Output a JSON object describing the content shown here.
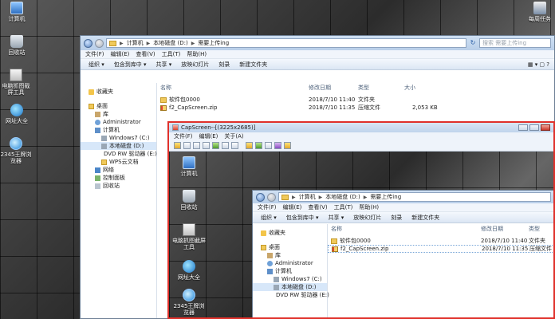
{
  "desktop": {
    "icons": [
      {
        "label": "计算机",
        "icon": "computer-icon"
      },
      {
        "label": "回收站",
        "icon": "recycle-bin-icon"
      },
      {
        "label": "电脑抓图截屏工具",
        "icon": "capture-tool-icon"
      },
      {
        "label": "网址大全",
        "icon": "web-directory-icon"
      },
      {
        "label": "2345王牌浏览器",
        "icon": "browser-icon"
      },
      {
        "label": "每周任务",
        "icon": "games-icon"
      }
    ]
  },
  "explorer": {
    "breadcrumb": [
      "计算机",
      "本地磁盘 (D:)",
      "需要上传ing"
    ],
    "search_placeholder": "搜索 需要上传ing",
    "menu": [
      "文件(F)",
      "编辑(E)",
      "查看(V)",
      "工具(T)",
      "帮助(H)"
    ],
    "commands": [
      "组织 ▾",
      "包含到库中 ▾",
      "共享 ▾",
      "放映幻灯片",
      "刻录",
      "新建文件夹"
    ],
    "columns": {
      "name": "名称",
      "date": "修改日期",
      "type": "类型",
      "size": "大小"
    },
    "files": [
      {
        "name": "软件包0000",
        "date": "2018/7/10 11:40",
        "type": "文件夹",
        "size": "",
        "icon": "folder-icon"
      },
      {
        "name": "f2_CapScreen.zip",
        "date": "2018/7/10 11:35",
        "type": "压缩文件",
        "size": "2,053 KB",
        "icon": "zip-icon"
      }
    ],
    "nav": [
      {
        "label": "收藏夹",
        "icon": "star",
        "level": 0
      },
      {
        "label": "桌面",
        "icon": "folder",
        "level": 0
      },
      {
        "label": "库",
        "icon": "lib",
        "level": 1
      },
      {
        "label": "Administrator",
        "icon": "user",
        "level": 1
      },
      {
        "label": "计算机",
        "icon": "pc",
        "level": 1
      },
      {
        "label": "Windows7 (C:)",
        "icon": "drive",
        "level": 2
      },
      {
        "label": "本地磁盘 (D:)",
        "icon": "drive",
        "level": 2,
        "selected": true
      },
      {
        "label": "DVD RW 驱动器 (E:)",
        "icon": "dvd",
        "level": 2
      },
      {
        "label": "WPS云文档",
        "icon": "folder",
        "level": 2
      },
      {
        "label": "网络",
        "icon": "net",
        "level": 1
      },
      {
        "label": "控制面板",
        "icon": "ctrl",
        "level": 1
      },
      {
        "label": "回收站",
        "icon": "bin",
        "level": 1
      }
    ]
  },
  "capscreen": {
    "title": "CapScreen--[(3225x2685)]",
    "menu": [
      "文件(F)",
      "编辑(E)",
      "关于(A)"
    ],
    "inner_explorer": {
      "breadcrumb": [
        "计算机",
        "本地磁盘 (D:)",
        "需要上传ing"
      ],
      "menu": [
        "文件(F)",
        "编辑(E)",
        "查看(V)",
        "工具(T)",
        "帮助(H)"
      ],
      "commands": [
        "组织 ▾",
        "包含到库中 ▾",
        "共享 ▾",
        "放映幻灯片",
        "刻录",
        "新建文件夹"
      ],
      "columns": {
        "name": "名称",
        "date": "修改日期",
        "type": "类型"
      },
      "files": [
        {
          "name": "软件包0000",
          "date": "2018/7/10 11:40",
          "type": "文件夹"
        },
        {
          "name": "f2_CapScreen.zip",
          "date": "2018/7/10 11:35",
          "type": "压缩文件"
        }
      ],
      "nav": [
        {
          "label": "收藏夹",
          "icon": "star",
          "level": 0
        },
        {
          "label": "桌面",
          "icon": "folder",
          "level": 0
        },
        {
          "label": "库",
          "icon": "lib",
          "level": 1
        },
        {
          "label": "Administrator",
          "icon": "user",
          "level": 1
        },
        {
          "label": "计算机",
          "icon": "pc",
          "level": 1
        },
        {
          "label": "Windows7 (C:)",
          "icon": "drive",
          "level": 2
        },
        {
          "label": "本地磁盘 (D:)",
          "icon": "drive",
          "level": 2,
          "selected": true
        },
        {
          "label": "DVD RW 驱动器 (E:)",
          "icon": "dvd",
          "level": 2
        }
      ]
    },
    "desktop_icons": [
      {
        "label": "计算机",
        "icon": "computer-icon"
      },
      {
        "label": "回收站",
        "icon": "recycle-bin-icon"
      },
      {
        "label": "电脑抓图截屏工具",
        "icon": "capture-tool-icon"
      },
      {
        "label": "网址大全",
        "icon": "web-directory-icon"
      },
      {
        "label": "2345王牌浏览器",
        "icon": "browser-icon"
      }
    ]
  },
  "colors": {
    "highlight_border": "#e0312b",
    "accent": "#2a5ea6"
  }
}
